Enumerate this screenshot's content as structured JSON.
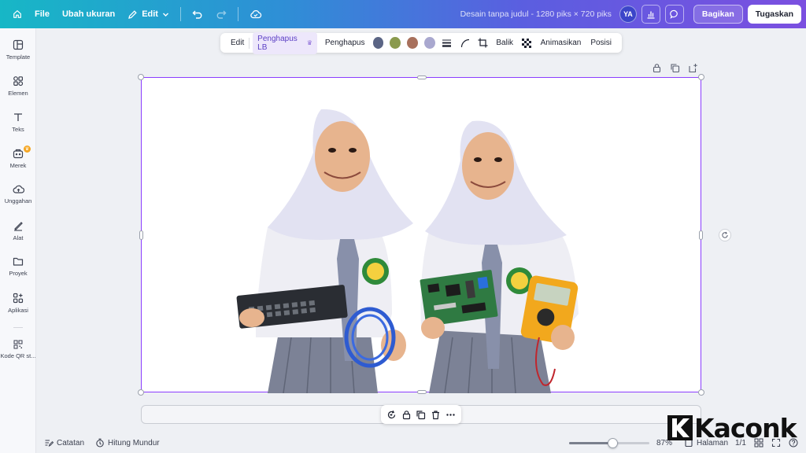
{
  "topbar": {
    "file": "File",
    "resize": "Ubah ukuran",
    "edit": "Edit",
    "title": "Desain tanpa judul - 1280 piks × 720 piks",
    "avatar": "YA",
    "share": "Bagikan",
    "submit": "Tugaskan"
  },
  "sidebar": {
    "items": [
      {
        "label": "Template",
        "icon": "template-icon"
      },
      {
        "label": "Elemen",
        "icon": "elements-icon"
      },
      {
        "label": "Teks",
        "icon": "text-icon"
      },
      {
        "label": "Merek",
        "icon": "brand-icon"
      },
      {
        "label": "Unggahan",
        "icon": "upload-icon"
      },
      {
        "label": "Alat",
        "icon": "tools-icon"
      },
      {
        "label": "Proyek",
        "icon": "folder-icon"
      },
      {
        "label": "Aplikasi",
        "icon": "apps-icon"
      },
      {
        "label": "Kode QR st...",
        "icon": "qr-code-icon"
      }
    ]
  },
  "context_toolbar": {
    "edit": "Edit",
    "bg_remover": "Penghapus LB",
    "eraser": "Penghapus",
    "colors": [
      "#5b6585",
      "#8a9a4e",
      "#a8705c",
      "#a9a8cf"
    ],
    "flip": "Balik",
    "animate": "Animasikan",
    "position": "Posisi"
  },
  "canvas": {
    "image_name": "students-holding-network-equipment"
  },
  "bottombar": {
    "notes": "Catatan",
    "timer": "Hitung Mundur",
    "zoom": "87%",
    "zoom_level": 0.54,
    "pages": "Halaman",
    "page_count": "1/1"
  },
  "watermark": {
    "brand": "Kaconk"
  }
}
